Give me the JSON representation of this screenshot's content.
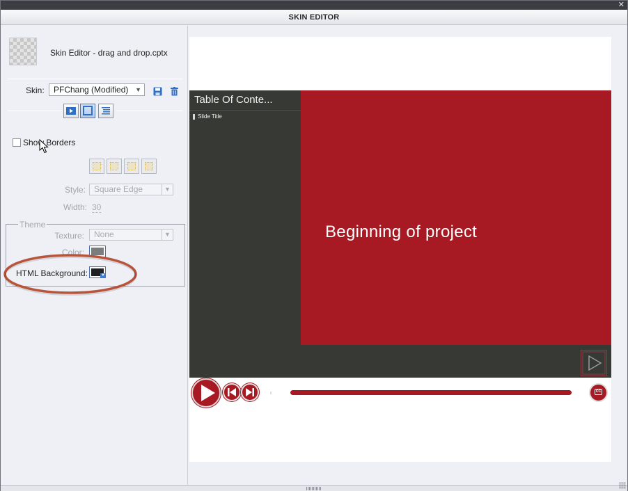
{
  "window": {
    "title": "SKIN EDITOR",
    "close_glyph": "✕"
  },
  "left_panel": {
    "file_name": "Skin Editor - drag and drop.cptx",
    "skin": {
      "label": "Skin:",
      "value": "PFChang (Modified)"
    },
    "icons": [
      "save-icon",
      "delete-icon"
    ],
    "tabs": [
      {
        "name": "playback-control",
        "active": false
      },
      {
        "name": "borders",
        "active": true
      },
      {
        "name": "table-of-contents",
        "active": false
      }
    ],
    "show_borders": {
      "label": "Show Borders",
      "checked": false
    },
    "style": {
      "label": "Style:",
      "value": "Square Edge"
    },
    "width": {
      "label": "Width:",
      "value": "30"
    },
    "theme": {
      "legend": "Theme",
      "texture": {
        "label": "Texture:",
        "value": "None"
      },
      "color": {
        "label": "Color:",
        "swatch": "#7a7c7e"
      },
      "html_background": {
        "label": "HTML Background:",
        "swatch": "#1f2124"
      }
    }
  },
  "preview": {
    "toc_title": "Table Of Conte...",
    "toc_items": [
      "Slide Title"
    ],
    "slide_text": "Beginning of project",
    "colors": {
      "accent": "#a71923",
      "player_bg": "#363934",
      "preview_bg": "#ffffff"
    },
    "controls": {
      "cc_label": "CC"
    }
  }
}
